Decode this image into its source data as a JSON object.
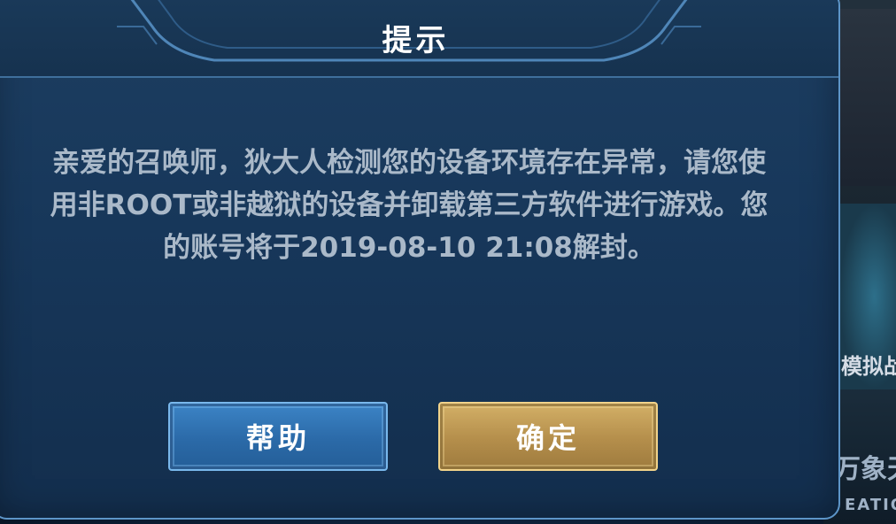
{
  "dialog": {
    "title": "提示",
    "message": "亲爱的召唤师，狄大人检测您的设备环境存在异常，请您使用非ROOT或非越狱的设备并卸载第三方软件进行游戏。您的账号将于2019-08-10 21:08解封。",
    "buttons": {
      "help_label": "帮助",
      "confirm_label": "确定"
    }
  },
  "background": {
    "label_mode": "模拟战",
    "label_bottom": "万象天",
    "label_bottom_sub": "EATIO"
  },
  "colors": {
    "dialog_bg": "#17375a",
    "dialog_border": "#5d95c8",
    "message_text": "#aab9c9",
    "help_button": "#2b6aa8",
    "confirm_button": "#b48e4b"
  }
}
